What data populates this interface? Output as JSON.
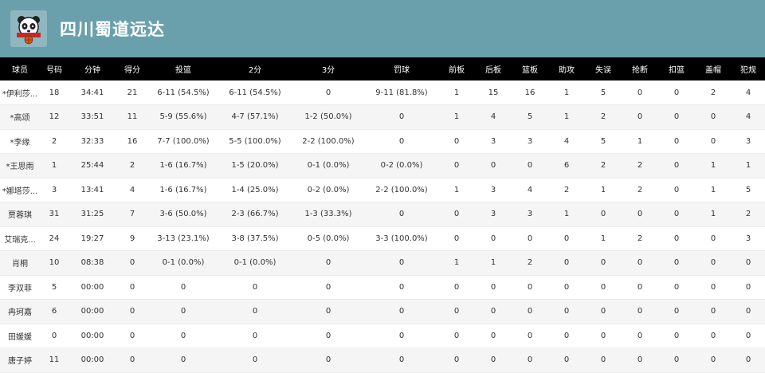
{
  "team": {
    "name": "四川蜀道远达",
    "logo_icon": "panda-basketball-logo"
  },
  "columns": [
    "球员",
    "号码",
    "分钟",
    "得分",
    "投篮",
    "2分",
    "3分",
    "罚球",
    "前板",
    "后板",
    "篮板",
    "助攻",
    "失误",
    "抢断",
    "扣篮",
    "盖帽",
    "犯规"
  ],
  "rows": [
    [
      "*伊利莎...",
      "18",
      "34:41",
      "21",
      "6-11 (54.5%)",
      "6-11 (54.5%)",
      "0",
      "9-11 (81.8%)",
      "1",
      "15",
      "16",
      "1",
      "5",
      "0",
      "0",
      "2",
      "4"
    ],
    [
      "*高颂",
      "12",
      "33:51",
      "11",
      "5-9 (55.6%)",
      "4-7 (57.1%)",
      "1-2 (50.0%)",
      "0",
      "1",
      "4",
      "5",
      "1",
      "2",
      "0",
      "0",
      "0",
      "4"
    ],
    [
      "*李缘",
      "2",
      "32:33",
      "16",
      "7-7 (100.0%)",
      "5-5 (100.0%)",
      "2-2 (100.0%)",
      "0",
      "0",
      "3",
      "3",
      "4",
      "5",
      "1",
      "0",
      "0",
      "3"
    ],
    [
      "*王思雨",
      "1",
      "25:44",
      "2",
      "1-6 (16.7%)",
      "1-5 (20.0%)",
      "0-1 (0.0%)",
      "0-2 (0.0%)",
      "0",
      "0",
      "0",
      "6",
      "2",
      "2",
      "0",
      "1",
      "1"
    ],
    [
      "*娜塔莎...",
      "3",
      "13:41",
      "4",
      "1-6 (16.7%)",
      "1-4 (25.0%)",
      "0-2 (0.0%)",
      "2-2 (100.0%)",
      "1",
      "3",
      "4",
      "2",
      "1",
      "2",
      "0",
      "1",
      "5"
    ],
    [
      "贾蓉琪",
      "31",
      "31:25",
      "7",
      "3-6 (50.0%)",
      "2-3 (66.7%)",
      "1-3 (33.3%)",
      "0",
      "0",
      "3",
      "3",
      "1",
      "0",
      "0",
      "0",
      "1",
      "2"
    ],
    [
      "艾瑞克...",
      "24",
      "19:27",
      "9",
      "3-13 (23.1%)",
      "3-8 (37.5%)",
      "0-5 (0.0%)",
      "3-3 (100.0%)",
      "0",
      "0",
      "0",
      "0",
      "1",
      "2",
      "0",
      "0",
      "3"
    ],
    [
      "肖桐",
      "10",
      "08:38",
      "0",
      "0-1 (0.0%)",
      "0-1 (0.0%)",
      "0",
      "0",
      "1",
      "1",
      "2",
      "0",
      "0",
      "0",
      "0",
      "0",
      "0"
    ],
    [
      "李双菲",
      "5",
      "00:00",
      "0",
      "0",
      "0",
      "0",
      "0",
      "0",
      "0",
      "0",
      "0",
      "0",
      "0",
      "0",
      "0",
      "0"
    ],
    [
      "冉珂嘉",
      "6",
      "00:00",
      "0",
      "0",
      "0",
      "0",
      "0",
      "0",
      "0",
      "0",
      "0",
      "0",
      "0",
      "0",
      "0",
      "0"
    ],
    [
      "田媛媛",
      "0",
      "00:00",
      "0",
      "0",
      "0",
      "0",
      "0",
      "0",
      "0",
      "0",
      "0",
      "0",
      "0",
      "0",
      "0",
      "0"
    ],
    [
      "唐子婷",
      "11",
      "00:00",
      "0",
      "0",
      "0",
      "0",
      "0",
      "0",
      "0",
      "0",
      "0",
      "0",
      "0",
      "0",
      "0",
      "0"
    ]
  ]
}
